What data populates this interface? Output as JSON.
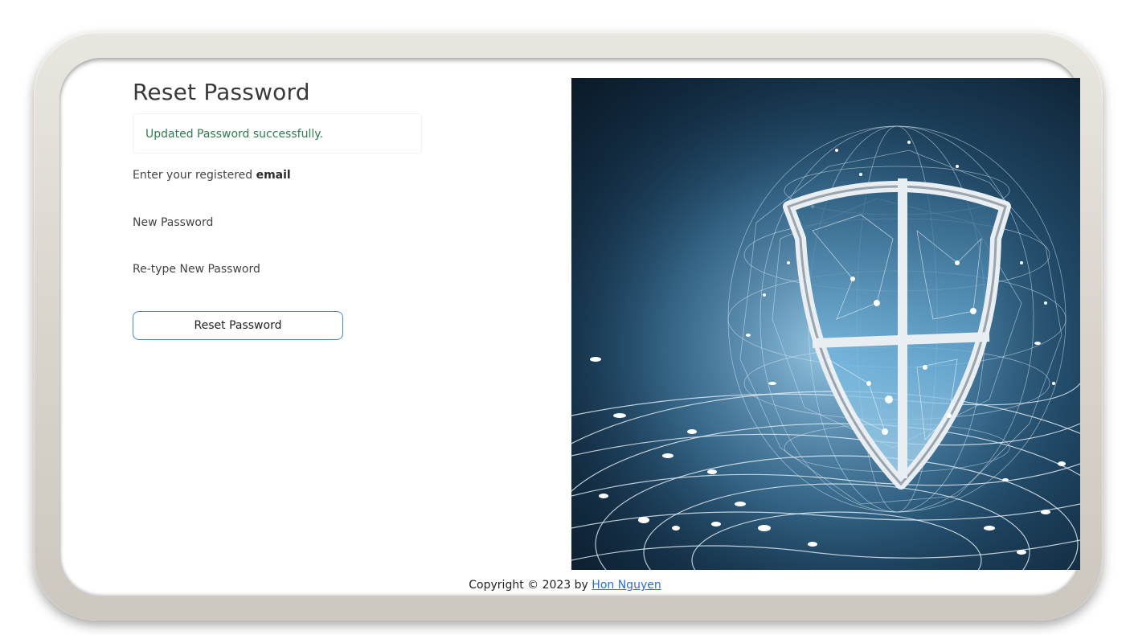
{
  "page": {
    "title": "Reset Password"
  },
  "alert": {
    "message": "Updated Password successfully.",
    "color": "#2f7a4f"
  },
  "form": {
    "email_label_prefix": "Enter your registered",
    "email_label_bold": "email",
    "new_password_label": "New Password",
    "retype_password_label": "Re-type New Password",
    "submit_label": "Reset Password"
  },
  "hero": {
    "icon": "security-shield-network-image"
  },
  "footer": {
    "copyright_prefix": "Copyright © 2023 by",
    "author_link": "Hon Nguyen"
  },
  "colors": {
    "accent": "#4a86c9",
    "link": "#2a6fd1"
  }
}
